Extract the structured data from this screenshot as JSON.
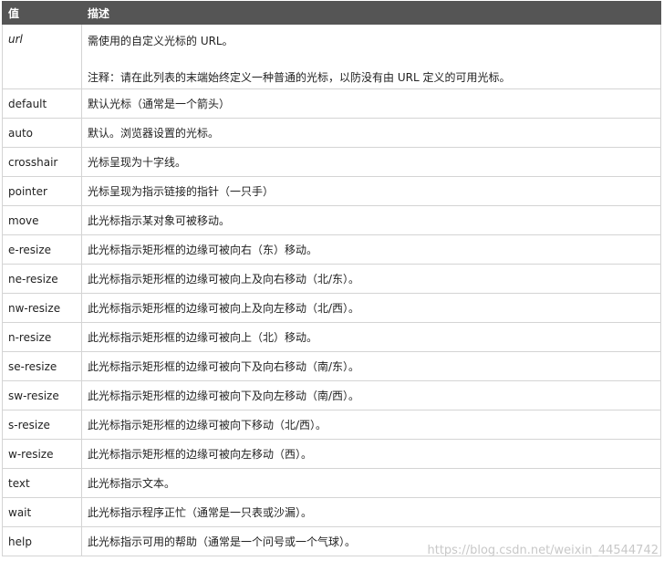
{
  "table": {
    "headers": [
      "值",
      "描述"
    ],
    "url_row": {
      "value": "url",
      "desc": "需使用的自定义光标的 URL。",
      "note": "注释：请在此列表的末端始终定义一种普通的光标，以防没有由 URL 定义的可用光标。"
    },
    "rows": [
      {
        "value": "default",
        "desc": "默认光标（通常是一个箭头）"
      },
      {
        "value": "auto",
        "desc": "默认。浏览器设置的光标。"
      },
      {
        "value": "crosshair",
        "desc": "光标呈现为十字线。"
      },
      {
        "value": "pointer",
        "desc": "光标呈现为指示链接的指针（一只手）"
      },
      {
        "value": "move",
        "desc": "此光标指示某对象可被移动。"
      },
      {
        "value": "e-resize",
        "desc": "此光标指示矩形框的边缘可被向右（东）移动。"
      },
      {
        "value": "ne-resize",
        "desc": "此光标指示矩形框的边缘可被向上及向右移动（北/东）。"
      },
      {
        "value": "nw-resize",
        "desc": "此光标指示矩形框的边缘可被向上及向左移动（北/西）。"
      },
      {
        "value": "n-resize",
        "desc": "此光标指示矩形框的边缘可被向上（北）移动。"
      },
      {
        "value": "se-resize",
        "desc": "此光标指示矩形框的边缘可被向下及向右移动（南/东）。"
      },
      {
        "value": "sw-resize",
        "desc": "此光标指示矩形框的边缘可被向下及向左移动（南/西）。"
      },
      {
        "value": "s-resize",
        "desc": "此光标指示矩形框的边缘可被向下移动（北/西）。"
      },
      {
        "value": "w-resize",
        "desc": "此光标指示矩形框的边缘可被向左移动（西）。"
      },
      {
        "value": "text",
        "desc": "此光标指示文本。"
      },
      {
        "value": "wait",
        "desc": "此光标指示程序正忙（通常是一只表或沙漏）。"
      },
      {
        "value": "help",
        "desc": "此光标指示可用的帮助（通常是一个问号或一个气球）。"
      }
    ]
  },
  "watermark": "https://blog.csdn.net/weixin_44544742"
}
